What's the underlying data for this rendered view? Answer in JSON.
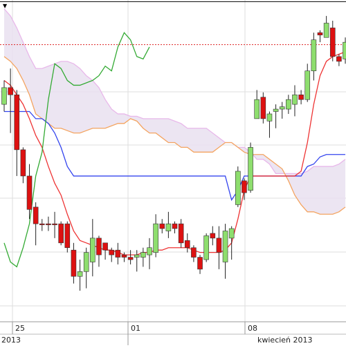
{
  "chart_data": {
    "type": "candlestick",
    "x_axis": {
      "day_ticks": [
        "25",
        "01",
        "08"
      ],
      "month_labels": [
        "2013",
        "kwiecień 2013"
      ]
    },
    "y_range": [
      0,
      100
    ],
    "candles": [
      {
        "o": 78,
        "c": 85,
        "h": 88,
        "l": 75,
        "up": true
      },
      {
        "o": 85,
        "c": 82,
        "h": 93,
        "l": 66,
        "up": false
      },
      {
        "o": 82,
        "c": 59,
        "h": 84,
        "l": 48,
        "up": false
      },
      {
        "o": 59,
        "c": 48,
        "h": 60,
        "l": 45,
        "up": false
      },
      {
        "o": 48,
        "c": 34,
        "h": 53,
        "l": 30,
        "up": false
      },
      {
        "o": 35,
        "c": 28,
        "h": 37,
        "l": 19,
        "up": false
      },
      {
        "o": 28,
        "c": 28,
        "h": 30,
        "l": 25,
        "up": false
      },
      {
        "o": 28,
        "c": 28,
        "h": 31,
        "l": 25,
        "up": false
      },
      {
        "o": 28,
        "c": 28,
        "h": 33,
        "l": 22,
        "up": false
      },
      {
        "o": 28,
        "c": 20,
        "h": 29,
        "l": 19,
        "up": false
      },
      {
        "o": 28,
        "c": 18,
        "h": 29,
        "l": 16,
        "up": false
      },
      {
        "o": 17,
        "c": 6,
        "h": 20,
        "l": 3,
        "up": false
      },
      {
        "o": 6,
        "c": 8,
        "h": 13,
        "l": 0,
        "up": true
      },
      {
        "o": 8,
        "c": 16,
        "h": 18,
        "l": 1,
        "up": true
      },
      {
        "o": 12,
        "c": 22,
        "h": 30,
        "l": 6,
        "up": true
      },
      {
        "o": 22,
        "c": 15,
        "h": 23,
        "l": 10,
        "up": false
      },
      {
        "o": 20,
        "c": 17,
        "h": 20,
        "l": 13,
        "up": false
      },
      {
        "o": 17,
        "c": 15,
        "h": 18,
        "l": 12,
        "up": false
      },
      {
        "o": 17,
        "c": 14,
        "h": 20,
        "l": 11,
        "up": false
      },
      {
        "o": 15,
        "c": 14,
        "h": 16,
        "l": 12,
        "up": false
      },
      {
        "o": 14,
        "c": 13,
        "h": 17,
        "l": 11,
        "up": false
      },
      {
        "o": 14,
        "c": 15,
        "h": 17,
        "l": 8,
        "up": true
      },
      {
        "o": 14,
        "c": 16,
        "h": 18,
        "l": 10,
        "up": true
      },
      {
        "o": 15,
        "c": 18,
        "h": 22,
        "l": 9,
        "up": true
      },
      {
        "o": 16,
        "c": 28,
        "h": 32,
        "l": 14,
        "up": true
      },
      {
        "o": 28,
        "c": 26,
        "h": 30,
        "l": 24,
        "up": false
      },
      {
        "o": 25,
        "c": 28,
        "h": 33,
        "l": 22,
        "up": true
      },
      {
        "o": 28,
        "c": 26,
        "h": 29,
        "l": 24,
        "up": false
      },
      {
        "o": 28,
        "c": 20,
        "h": 30,
        "l": 18,
        "up": false
      },
      {
        "o": 21,
        "c": 18,
        "h": 24,
        "l": 16,
        "up": false
      },
      {
        "o": 18,
        "c": 14,
        "h": 19,
        "l": 12,
        "up": false
      },
      {
        "o": 14,
        "c": 9,
        "h": 15,
        "l": 7,
        "up": false
      },
      {
        "o": 13,
        "c": 23,
        "h": 24,
        "l": 12,
        "up": true
      },
      {
        "o": 24,
        "c": 22,
        "h": 27,
        "l": 19,
        "up": false
      },
      {
        "o": 22,
        "c": 16,
        "h": 27,
        "l": 9,
        "up": false
      },
      {
        "o": 12,
        "c": 25,
        "h": 28,
        "l": 5,
        "up": true
      },
      {
        "o": 22,
        "c": 26,
        "h": 27,
        "l": 13,
        "up": true
      },
      {
        "o": 36,
        "c": 50,
        "h": 52,
        "l": 35,
        "up": true
      },
      {
        "o": 46,
        "c": 41,
        "h": 47,
        "l": 38,
        "up": false
      },
      {
        "o": 42,
        "c": 60,
        "h": 62,
        "l": 41,
        "up": true
      },
      {
        "o": 72,
        "c": 80,
        "h": 84,
        "l": 72,
        "up": true
      },
      {
        "o": 81,
        "c": 72,
        "h": 83,
        "l": 70,
        "up": false
      },
      {
        "o": 71,
        "c": 74,
        "h": 75,
        "l": 64,
        "up": true
      },
      {
        "o": 75,
        "c": 76,
        "h": 78,
        "l": 68,
        "up": true
      },
      {
        "o": 76,
        "c": 77,
        "h": 79,
        "l": 72,
        "up": true
      },
      {
        "o": 76,
        "c": 80,
        "h": 82,
        "l": 74,
        "up": true
      },
      {
        "o": 78,
        "c": 82,
        "h": 86,
        "l": 73,
        "up": true
      },
      {
        "o": 82,
        "c": 80,
        "h": 84,
        "l": 78,
        "up": false
      },
      {
        "o": 80,
        "c": 92,
        "h": 95,
        "l": 79,
        "up": true
      },
      {
        "o": 92,
        "c": 105,
        "h": 108,
        "l": 88,
        "up": true
      },
      {
        "o": 108,
        "c": 107,
        "h": 109,
        "l": 104,
        "up": false
      },
      {
        "o": 106,
        "c": 112,
        "h": 115,
        "l": 106,
        "up": true
      },
      {
        "o": 110,
        "c": 98,
        "h": 113,
        "l": 96,
        "up": false
      },
      {
        "o": 98,
        "c": 96,
        "h": 99,
        "l": 94,
        "up": false
      },
      {
        "o": 97,
        "c": 104,
        "h": 106,
        "l": 95,
        "up": true
      }
    ],
    "lines": {
      "tenkan": {
        "color": "#ee3333",
        "values": [
          88,
          86,
          82,
          78,
          72,
          65,
          60,
          52,
          45,
          40,
          32,
          25,
          21,
          20,
          19,
          18,
          17,
          17,
          16,
          15,
          15,
          15,
          16,
          16,
          17,
          17,
          18,
          18,
          18,
          18,
          17,
          16,
          16,
          16,
          16,
          17,
          20,
          30,
          42,
          48,
          48,
          48,
          48,
          48,
          48,
          48,
          48,
          50,
          62,
          78,
          90,
          96,
          98,
          99,
          100
        ]
      },
      "kijun": {
        "color": "#3344ee",
        "values": [
          75,
          75,
          75,
          75,
          75,
          72,
          72,
          70,
          66,
          60,
          52,
          48,
          48,
          48,
          48,
          48,
          48,
          48,
          48,
          48,
          48,
          48,
          48,
          48,
          48,
          48,
          48,
          48,
          48,
          48,
          48,
          48,
          48,
          48,
          48,
          48,
          38,
          42,
          48,
          48,
          48,
          48,
          48,
          48,
          48,
          48,
          48,
          48,
          52,
          53,
          56,
          57,
          57,
          57,
          57
        ]
      },
      "chikou": {
        "color": "#33aa33",
        "values": [
          20,
          12,
          10,
          18,
          28,
          48,
          58,
          80,
          95,
          93,
          88,
          86,
          86,
          87,
          88,
          90,
          94,
          92,
          102,
          108,
          105,
          98,
          97,
          102
        ]
      },
      "span_a": {
        "color": "#f4a460",
        "values": [
          98,
          96,
          93,
          88,
          82,
          74,
          72,
          70,
          68,
          68,
          67,
          66,
          66,
          67,
          68,
          68,
          68,
          69,
          70,
          70,
          72,
          71,
          68,
          66,
          66,
          64,
          62,
          62,
          60,
          60,
          58,
          58,
          58,
          58,
          60,
          62,
          62,
          60,
          58,
          57,
          57,
          57,
          55,
          53,
          51,
          46,
          40,
          36,
          33,
          33,
          32,
          32,
          32,
          33,
          35
        ]
      },
      "span_b": {
        "color": "#e8b8ea",
        "values": [
          118,
          115,
          110,
          104,
          98,
          93,
          93,
          94,
          95,
          96,
          96,
          95,
          93,
          90,
          88,
          85,
          80,
          76,
          74,
          74,
          73,
          73,
          72,
          72,
          72,
          72,
          72,
          71,
          70,
          68,
          68,
          68,
          68,
          66,
          64,
          62,
          62,
          60,
          60,
          58,
          55,
          55,
          53,
          49,
          49,
          49,
          49,
          49,
          50,
          52,
          52,
          52,
          52,
          53,
          55
        ]
      }
    },
    "reference_line": {
      "value": 103,
      "color": "#dd2222"
    },
    "horizontal_rule": {
      "value": 121
    },
    "colors": {
      "up": "#8ede6e",
      "down": "#dd1111",
      "cloud": "#e9e0f0",
      "grid": "#dddddd"
    }
  }
}
